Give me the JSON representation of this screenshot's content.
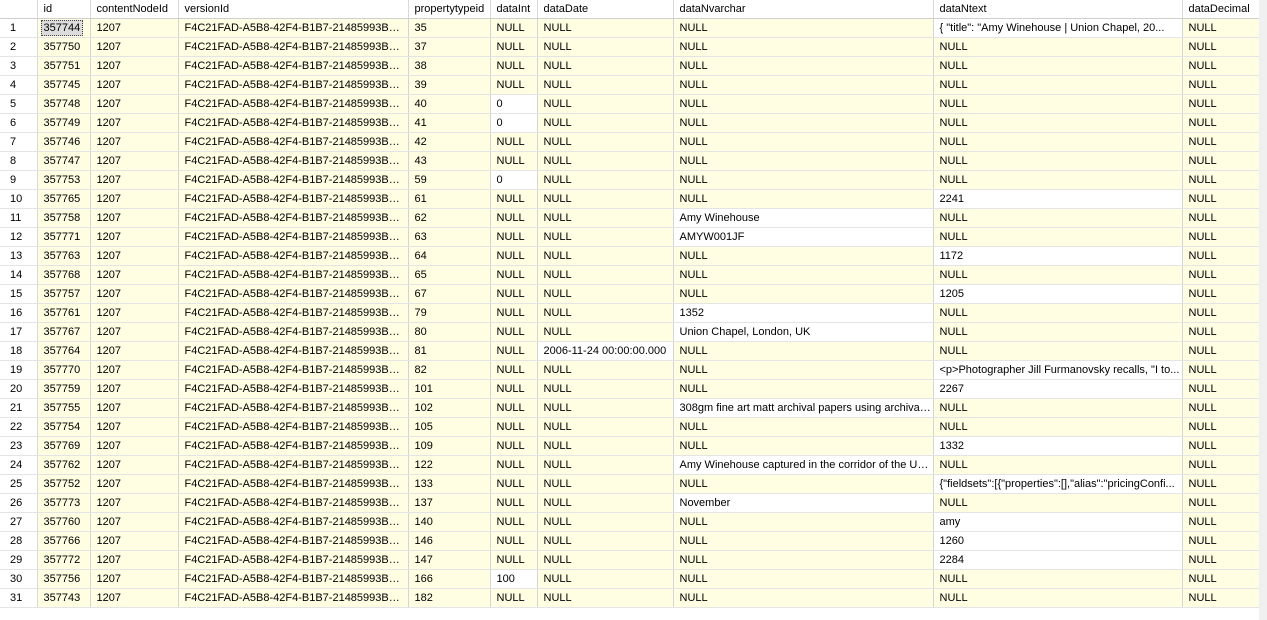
{
  "columns": [
    "id",
    "contentNodeId",
    "versionId",
    "propertytypeid",
    "dataInt",
    "dataDate",
    "dataNvarchar",
    "dataNtext",
    "dataDecimal"
  ],
  "rows": [
    {
      "n": "1",
      "id": "357744",
      "cn": "1207",
      "ver": "F4C21FAD-A5B8-42F4-B1B7-21485993BCB5",
      "pt": "35",
      "dint": "NULL",
      "ddate": "NULL",
      "dnv": "NULL",
      "dnt": "{    \"title\": \"Amy Winehouse | Union Chapel, 20...",
      "ddec": "NULL"
    },
    {
      "n": "2",
      "id": "357750",
      "cn": "1207",
      "ver": "F4C21FAD-A5B8-42F4-B1B7-21485993BCB5",
      "pt": "37",
      "dint": "NULL",
      "ddate": "NULL",
      "dnv": "NULL",
      "dnt": "NULL",
      "ddec": "NULL"
    },
    {
      "n": "3",
      "id": "357751",
      "cn": "1207",
      "ver": "F4C21FAD-A5B8-42F4-B1B7-21485993BCB5",
      "pt": "38",
      "dint": "NULL",
      "ddate": "NULL",
      "dnv": "NULL",
      "dnt": "NULL",
      "ddec": "NULL"
    },
    {
      "n": "4",
      "id": "357745",
      "cn": "1207",
      "ver": "F4C21FAD-A5B8-42F4-B1B7-21485993BCB5",
      "pt": "39",
      "dint": "NULL",
      "ddate": "NULL",
      "dnv": "NULL",
      "dnt": "NULL",
      "ddec": "NULL"
    },
    {
      "n": "5",
      "id": "357748",
      "cn": "1207",
      "ver": "F4C21FAD-A5B8-42F4-B1B7-21485993BCB5",
      "pt": "40",
      "dint": "0",
      "ddate": "NULL",
      "dnv": "NULL",
      "dnt": "NULL",
      "ddec": "NULL"
    },
    {
      "n": "6",
      "id": "357749",
      "cn": "1207",
      "ver": "F4C21FAD-A5B8-42F4-B1B7-21485993BCB5",
      "pt": "41",
      "dint": "0",
      "ddate": "NULL",
      "dnv": "NULL",
      "dnt": "NULL",
      "ddec": "NULL"
    },
    {
      "n": "7",
      "id": "357746",
      "cn": "1207",
      "ver": "F4C21FAD-A5B8-42F4-B1B7-21485993BCB5",
      "pt": "42",
      "dint": "NULL",
      "ddate": "NULL",
      "dnv": "NULL",
      "dnt": "NULL",
      "ddec": "NULL"
    },
    {
      "n": "8",
      "id": "357747",
      "cn": "1207",
      "ver": "F4C21FAD-A5B8-42F4-B1B7-21485993BCB5",
      "pt": "43",
      "dint": "NULL",
      "ddate": "NULL",
      "dnv": "NULL",
      "dnt": "NULL",
      "ddec": "NULL"
    },
    {
      "n": "9",
      "id": "357753",
      "cn": "1207",
      "ver": "F4C21FAD-A5B8-42F4-B1B7-21485993BCB5",
      "pt": "59",
      "dint": "0",
      "ddate": "NULL",
      "dnv": "NULL",
      "dnt": "NULL",
      "ddec": "NULL"
    },
    {
      "n": "10",
      "id": "357765",
      "cn": "1207",
      "ver": "F4C21FAD-A5B8-42F4-B1B7-21485993BCB5",
      "pt": "61",
      "dint": "NULL",
      "ddate": "NULL",
      "dnv": "NULL",
      "dnt": "2241",
      "ddec": "NULL"
    },
    {
      "n": "11",
      "id": "357758",
      "cn": "1207",
      "ver": "F4C21FAD-A5B8-42F4-B1B7-21485993BCB5",
      "pt": "62",
      "dint": "NULL",
      "ddate": "NULL",
      "dnv": "Amy Winehouse",
      "dnt": "NULL",
      "ddec": "NULL"
    },
    {
      "n": "12",
      "id": "357771",
      "cn": "1207",
      "ver": "F4C21FAD-A5B8-42F4-B1B7-21485993BCB5",
      "pt": "63",
      "dint": "NULL",
      "ddate": "NULL",
      "dnv": "AMYW001JF",
      "dnt": "NULL",
      "ddec": "NULL"
    },
    {
      "n": "13",
      "id": "357763",
      "cn": "1207",
      "ver": "F4C21FAD-A5B8-42F4-B1B7-21485993BCB5",
      "pt": "64",
      "dint": "NULL",
      "ddate": "NULL",
      "dnv": "NULL",
      "dnt": "1172",
      "ddec": "NULL"
    },
    {
      "n": "14",
      "id": "357768",
      "cn": "1207",
      "ver": "F4C21FAD-A5B8-42F4-B1B7-21485993BCB5",
      "pt": "65",
      "dint": "NULL",
      "ddate": "NULL",
      "dnv": "NULL",
      "dnt": "NULL",
      "ddec": "NULL"
    },
    {
      "n": "15",
      "id": "357757",
      "cn": "1207",
      "ver": "F4C21FAD-A5B8-42F4-B1B7-21485993BCB5",
      "pt": "67",
      "dint": "NULL",
      "ddate": "NULL",
      "dnv": "NULL",
      "dnt": "1205",
      "ddec": "NULL"
    },
    {
      "n": "16",
      "id": "357761",
      "cn": "1207",
      "ver": "F4C21FAD-A5B8-42F4-B1B7-21485993BCB5",
      "pt": "79",
      "dint": "NULL",
      "ddate": "NULL",
      "dnv": "1352",
      "dnt": "NULL",
      "ddec": "NULL"
    },
    {
      "n": "17",
      "id": "357767",
      "cn": "1207",
      "ver": "F4C21FAD-A5B8-42F4-B1B7-21485993BCB5",
      "pt": "80",
      "dint": "NULL",
      "ddate": "NULL",
      "dnv": "Union Chapel, London, UK",
      "dnt": "NULL",
      "ddec": "NULL"
    },
    {
      "n": "18",
      "id": "357764",
      "cn": "1207",
      "ver": "F4C21FAD-A5B8-42F4-B1B7-21485993BCB5",
      "pt": "81",
      "dint": "NULL",
      "ddate": "2006-11-24 00:00:00.000",
      "dnv": "NULL",
      "dnt": "NULL",
      "ddec": "NULL"
    },
    {
      "n": "19",
      "id": "357770",
      "cn": "1207",
      "ver": "F4C21FAD-A5B8-42F4-B1B7-21485993BCB5",
      "pt": "82",
      "dint": "NULL",
      "ddate": "NULL",
      "dnv": "NULL",
      "dnt": "<p>Photographer Jill Furmanovsky recalls, \"I to...",
      "ddec": "NULL"
    },
    {
      "n": "20",
      "id": "357759",
      "cn": "1207",
      "ver": "F4C21FAD-A5B8-42F4-B1B7-21485993BCB5",
      "pt": "101",
      "dint": "NULL",
      "ddate": "NULL",
      "dnv": "NULL",
      "dnt": "2267",
      "ddec": "NULL"
    },
    {
      "n": "21",
      "id": "357755",
      "cn": "1207",
      "ver": "F4C21FAD-A5B8-42F4-B1B7-21485993BCB5",
      "pt": "102",
      "dint": "NULL",
      "ddate": "NULL",
      "dnv": "308gm fine art matt archival papers using archival ...",
      "dnt": "NULL",
      "ddec": "NULL"
    },
    {
      "n": "22",
      "id": "357754",
      "cn": "1207",
      "ver": "F4C21FAD-A5B8-42F4-B1B7-21485993BCB5",
      "pt": "105",
      "dint": "NULL",
      "ddate": "NULL",
      "dnv": "NULL",
      "dnt": "NULL",
      "ddec": "NULL"
    },
    {
      "n": "23",
      "id": "357769",
      "cn": "1207",
      "ver": "F4C21FAD-A5B8-42F4-B1B7-21485993BCB5",
      "pt": "109",
      "dint": "NULL",
      "ddate": "NULL",
      "dnv": "NULL",
      "dnt": "1332",
      "ddec": "NULL"
    },
    {
      "n": "24",
      "id": "357762",
      "cn": "1207",
      "ver": "F4C21FAD-A5B8-42F4-B1B7-21485993BCB5",
      "pt": "122",
      "dint": "NULL",
      "ddate": "NULL",
      "dnv": "Amy Winehouse captured in the corridor of the Un...",
      "dnt": "NULL",
      "ddec": "NULL"
    },
    {
      "n": "25",
      "id": "357752",
      "cn": "1207",
      "ver": "F4C21FAD-A5B8-42F4-B1B7-21485993BCB5",
      "pt": "133",
      "dint": "NULL",
      "ddate": "NULL",
      "dnv": "NULL",
      "dnt": "{\"fieldsets\":[{\"properties\":[],\"alias\":\"pricingConfi...",
      "ddec": "NULL"
    },
    {
      "n": "26",
      "id": "357773",
      "cn": "1207",
      "ver": "F4C21FAD-A5B8-42F4-B1B7-21485993BCB5",
      "pt": "137",
      "dint": "NULL",
      "ddate": "NULL",
      "dnv": "November",
      "dnt": "NULL",
      "ddec": "NULL"
    },
    {
      "n": "27",
      "id": "357760",
      "cn": "1207",
      "ver": "F4C21FAD-A5B8-42F4-B1B7-21485993BCB5",
      "pt": "140",
      "dint": "NULL",
      "ddate": "NULL",
      "dnv": "NULL",
      "dnt": "amy",
      "ddec": "NULL"
    },
    {
      "n": "28",
      "id": "357766",
      "cn": "1207",
      "ver": "F4C21FAD-A5B8-42F4-B1B7-21485993BCB5",
      "pt": "146",
      "dint": "NULL",
      "ddate": "NULL",
      "dnv": "NULL",
      "dnt": "1260",
      "ddec": "NULL"
    },
    {
      "n": "29",
      "id": "357772",
      "cn": "1207",
      "ver": "F4C21FAD-A5B8-42F4-B1B7-21485993BCB5",
      "pt": "147",
      "dint": "NULL",
      "ddate": "NULL",
      "dnv": "NULL",
      "dnt": "2284",
      "ddec": "NULL"
    },
    {
      "n": "30",
      "id": "357756",
      "cn": "1207",
      "ver": "F4C21FAD-A5B8-42F4-B1B7-21485993BCB5",
      "pt": "166",
      "dint": "100",
      "ddate": "NULL",
      "dnv": "NULL",
      "dnt": "NULL",
      "ddec": "NULL"
    },
    {
      "n": "31",
      "id": "357743",
      "cn": "1207",
      "ver": "F4C21FAD-A5B8-42F4-B1B7-21485993BCB5",
      "pt": "182",
      "dint": "NULL",
      "ddate": "NULL",
      "dnv": "NULL",
      "dnt": "NULL",
      "ddec": "NULL"
    }
  ],
  "colors": {
    "null_cell_bg": "#fffde2",
    "value_cell_bg": "#ffffff",
    "selection_bg": "#dcdcdc"
  }
}
